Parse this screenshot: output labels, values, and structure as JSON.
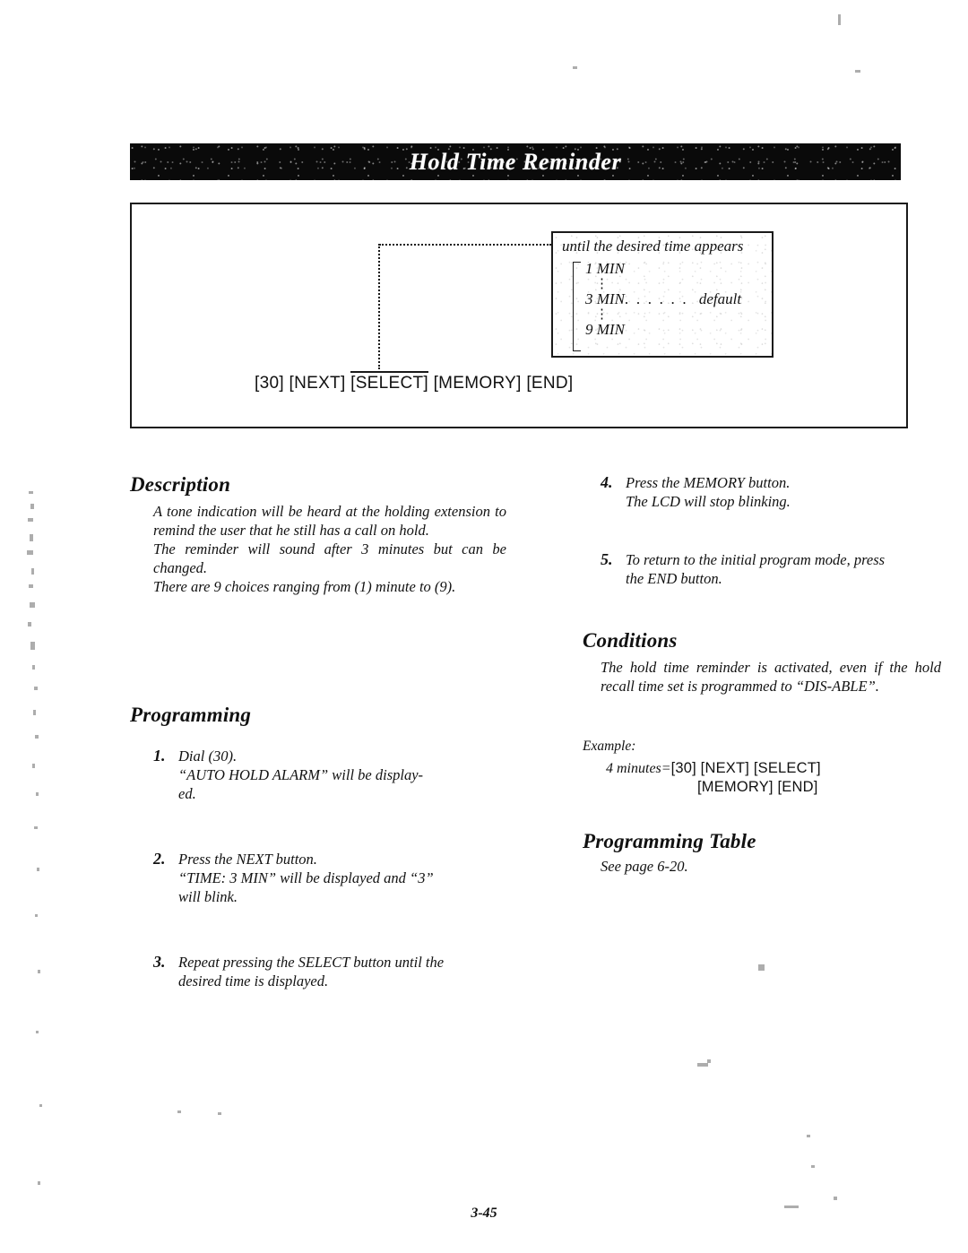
{
  "page": {
    "number": "3-45"
  },
  "header": {
    "title": "Hold Time Reminder"
  },
  "diagram": {
    "callout": {
      "heading": "until the desired time appears",
      "options": [
        {
          "label": "1 MIN",
          "leader": "",
          "note": ""
        },
        {
          "label": "3 MIN",
          "leader": ". . . . . .",
          "note": "default"
        },
        {
          "label": "9 MIN",
          "leader": "",
          "note": ""
        }
      ],
      "vertical_dots": "⋮"
    },
    "key_sequence": {
      "keys": [
        "[30]",
        "[NEXT]",
        "[SELECT]",
        "[MEMORY]",
        "[END]"
      ],
      "overlined_key": "[SELECT]"
    }
  },
  "description": {
    "heading": "Description",
    "paragraphs": [
      "A tone indication will be heard at the holding extension to remind the user that he still has a call on hold.",
      "The reminder will sound after 3 minutes but can be changed.",
      "There are 9 choices ranging from (1) minute to (9)."
    ]
  },
  "programming": {
    "heading": "Programming",
    "steps": [
      {
        "number": "1.",
        "lines": [
          "Dial  (30).",
          "“AUTO HOLD ALARM” will be display-",
          "ed."
        ]
      },
      {
        "number": "2.",
        "lines": [
          "Press  the  NEXT  button.",
          "“TIME: 3 MIN” will be displayed and “3”",
          "will  blink."
        ]
      },
      {
        "number": "3.",
        "lines": [
          "Repeat pressing the SELECT button until the",
          "desired  time  is  displayed."
        ]
      },
      {
        "number": "4.",
        "lines": [
          "Press  the  MEMORY  button.",
          "The  LCD  will  stop  blinking."
        ]
      },
      {
        "number": "5.",
        "lines": [
          "To return to the initial program mode, press",
          "the  END  button."
        ]
      }
    ]
  },
  "conditions": {
    "heading": "Conditions",
    "text": "The hold time reminder is activated, even if the hold recall time set is programmed to “DIS-ABLE”."
  },
  "example": {
    "label": "Example:",
    "lhs": "4  minutes=",
    "keys_line1": "[30]  [NEXT]  [SELECT]",
    "keys_line2": "[MEMORY]  [END]"
  },
  "programming_table": {
    "heading": "Programming Table",
    "reference": "See  page  6-20."
  }
}
